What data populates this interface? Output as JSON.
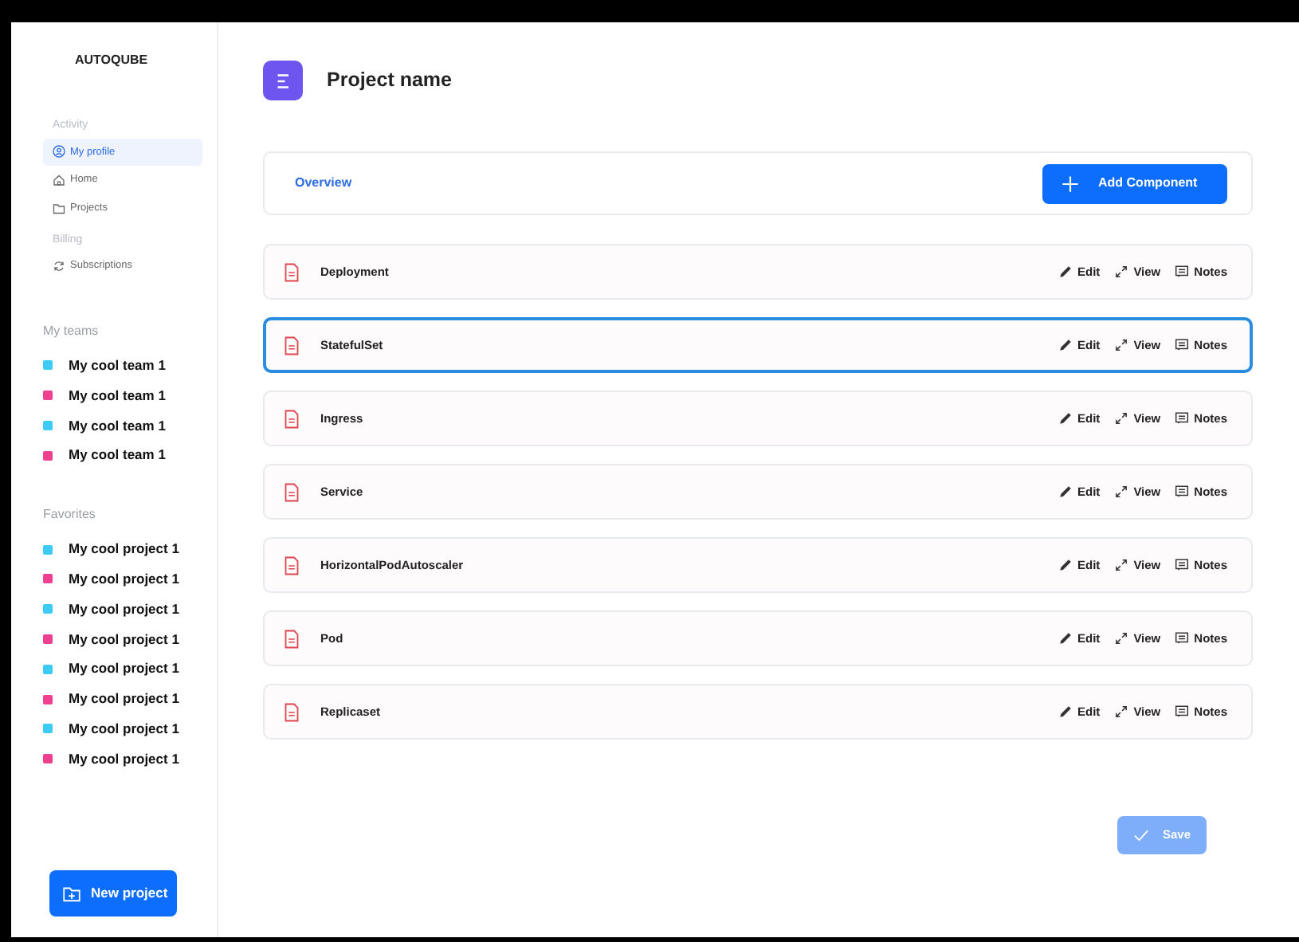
{
  "sidebar": {
    "logo": "AUTOQUBE",
    "sections": [
      {
        "heading": "Activity",
        "items": [
          {
            "label": "My profile",
            "selected": true
          },
          {
            "label": "Home",
            "selected": false
          },
          {
            "label": "Projects",
            "selected": false
          }
        ]
      },
      {
        "heading": "Billing",
        "items": [
          {
            "label": "Subscriptions",
            "selected": false
          }
        ]
      }
    ],
    "teams": {
      "heading": "My teams",
      "items": [
        {
          "label": "My cool team 1",
          "color": "#3ccbf4"
        },
        {
          "label": "My cool team 1",
          "color": "#ef3f8f"
        },
        {
          "label": "My cool team 1",
          "color": "#3ccbf4"
        },
        {
          "label": "My cool team 1",
          "color": "#ef3f8f"
        }
      ]
    },
    "favorites": {
      "heading": "Favorites",
      "items": [
        {
          "label": "My cool project 1",
          "color": "#3ccbf4"
        },
        {
          "label": "My cool project 1",
          "color": "#ef3f8f"
        },
        {
          "label": "My cool project 1",
          "color": "#3ccbf4"
        },
        {
          "label": "My cool project 1",
          "color": "#ef3f8f"
        },
        {
          "label": "My cool project 1",
          "color": "#3ccbf4"
        },
        {
          "label": "My cool project 1",
          "color": "#ef3f8f"
        },
        {
          "label": "My cool project 1",
          "color": "#3ccbf4"
        },
        {
          "label": "My cool project 1",
          "color": "#ef3f8f"
        }
      ]
    },
    "new_project_button": "New project"
  },
  "header": {
    "title": "Project name"
  },
  "toolbar": {
    "tab": "Overview",
    "add_button": "Add Component"
  },
  "components": [
    {
      "name": "Deployment",
      "selected": false,
      "actions": [
        "Edit",
        "View",
        "Notes"
      ]
    },
    {
      "name": "StatefulSet",
      "selected": true,
      "actions": [
        "Edit",
        "View",
        "Notes"
      ]
    },
    {
      "name": "Ingress",
      "selected": false,
      "actions": [
        "Edit",
        "View",
        "Notes"
      ]
    },
    {
      "name": "Service",
      "selected": false,
      "actions": [
        "Edit",
        "View",
        "Notes"
      ]
    },
    {
      "name": "HorizontalPodAutoscaler",
      "selected": false,
      "actions": [
        "Edit",
        "View",
        "Notes"
      ]
    },
    {
      "name": "Pod",
      "selected": false,
      "actions": [
        "Edit",
        "View",
        "Notes"
      ]
    },
    {
      "name": "Replicaset",
      "selected": false,
      "actions": [
        "Edit",
        "View",
        "Notes"
      ]
    }
  ],
  "save_button": {
    "label": "Save",
    "disabled": true
  }
}
